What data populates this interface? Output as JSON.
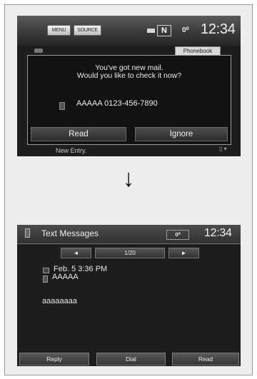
{
  "screen1": {
    "top_bar": {
      "menu_label": "MENU",
      "source_label": "SOURCE",
      "gear": "N",
      "status": "0⁰",
      "clock": "12:34"
    },
    "tab_label": "Phonebook",
    "bg_bottom_text": "New Entry.",
    "popup": {
      "message_line1": "You've got new mail.",
      "message_line2": "Would you like to check it now?",
      "contact": "AAAAA 0123-456-7890",
      "read_label": "Read",
      "ignore_label": "Ignore"
    }
  },
  "arrow": "↓",
  "screen2": {
    "title": "Text Messages",
    "status": "0⁰",
    "clock": "12:34",
    "nav": {
      "prev": "◄",
      "page": "1/20",
      "next": "►"
    },
    "message": {
      "date": "Feb. 5 3:36 PM",
      "sender": "AAAAA",
      "body": "aaaaaaaa"
    },
    "buttons": {
      "reply": "Reply",
      "dial": "Dial",
      "read": "Read"
    }
  }
}
